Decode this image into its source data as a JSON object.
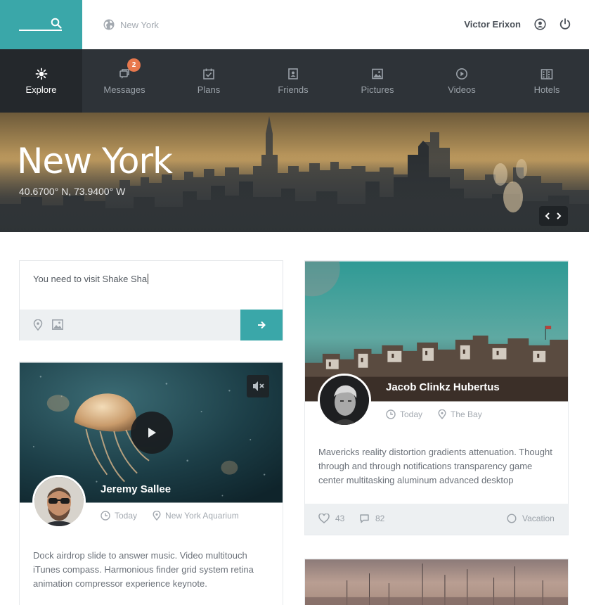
{
  "header": {
    "location": "New York",
    "user_name": "Victor Erixon"
  },
  "nav": {
    "items": [
      {
        "label": "Explore",
        "icon": "explore-icon",
        "active": true
      },
      {
        "label": "Messages",
        "icon": "messages-icon",
        "badge": "2"
      },
      {
        "label": "Plans",
        "icon": "plans-icon"
      },
      {
        "label": "Friends",
        "icon": "friends-icon"
      },
      {
        "label": "Pictures",
        "icon": "pictures-icon"
      },
      {
        "label": "Videos",
        "icon": "videos-icon"
      },
      {
        "label": "Hotels",
        "icon": "hotels-icon"
      }
    ]
  },
  "hero": {
    "title": "New York",
    "coordinates": "40.6700° N, 73.9400° W"
  },
  "composer": {
    "text": "You need to visit Shake Sha"
  },
  "cards": {
    "jeremy": {
      "author": "Jeremy Sallee",
      "time": "Today",
      "place": "New York Aquarium",
      "body": "Dock airdrop slide to answer music. Video multitouch iTunes compass. Harmonious finder grid system retina animation compressor experience keynote."
    },
    "jacob": {
      "author": "Jacob Clinkz Hubertus",
      "time": "Today",
      "place": "The Bay",
      "body": "Mavericks reality distortion gradients attenuation. Thought through and through notifications transparency game center multitasking aluminum advanced desktop",
      "likes": "43",
      "comments": "82",
      "tag": "Vacation"
    }
  },
  "colors": {
    "accent": "#3aa7a9",
    "nav_bg": "#2e3338",
    "badge": "#e8784d"
  }
}
